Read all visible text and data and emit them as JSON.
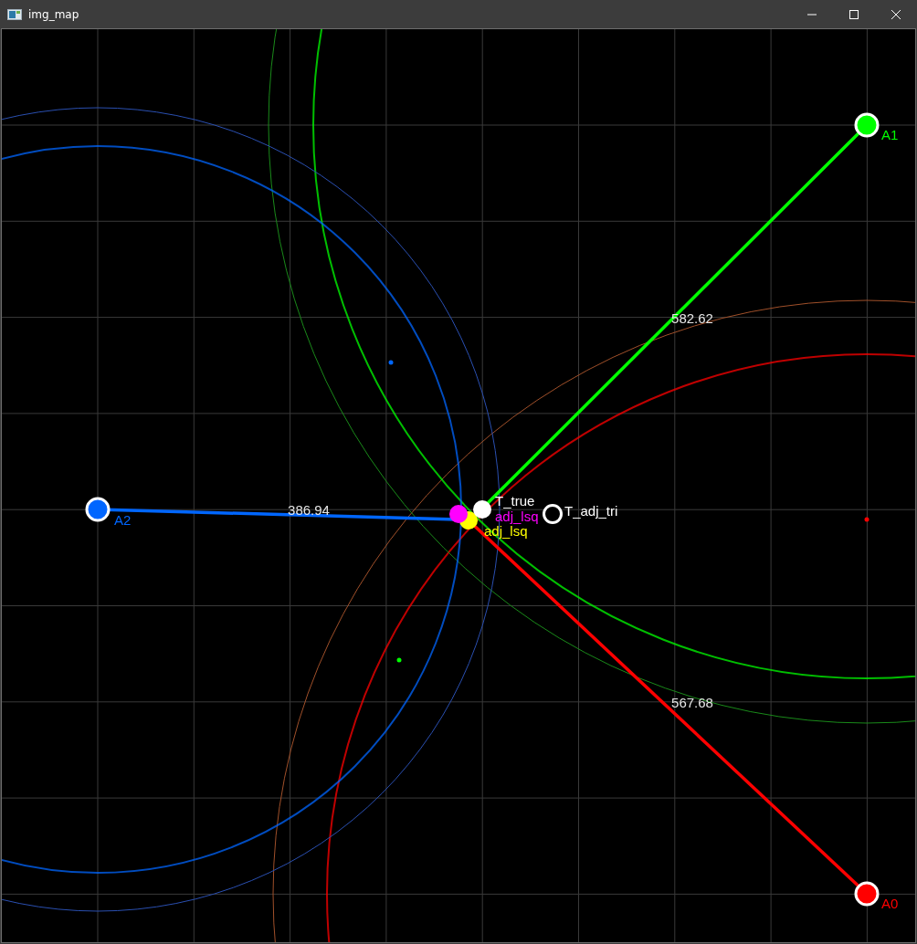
{
  "window": {
    "title": "img_map"
  },
  "anchors": [
    {
      "label": "A0",
      "color": "#ff0000"
    },
    {
      "label": "A1",
      "color": "#00ff00"
    },
    {
      "label": "A2",
      "color": "#0066ff"
    }
  ],
  "ranges": [
    {
      "label": "567.68"
    },
    {
      "label": "582.62"
    },
    {
      "label": "386.94"
    }
  ],
  "estimates": [
    {
      "label": "T_true",
      "color": "#ffffff",
      "kind": "dot"
    },
    {
      "label": "adj_lsq",
      "color": "#ff00ff",
      "kind": "dot"
    },
    {
      "label": "adj_lsq",
      "color": "#ffff00",
      "kind": "dot"
    },
    {
      "label": "T_adj_tri",
      "color": "#ffffff",
      "kind": "ring"
    }
  ]
}
